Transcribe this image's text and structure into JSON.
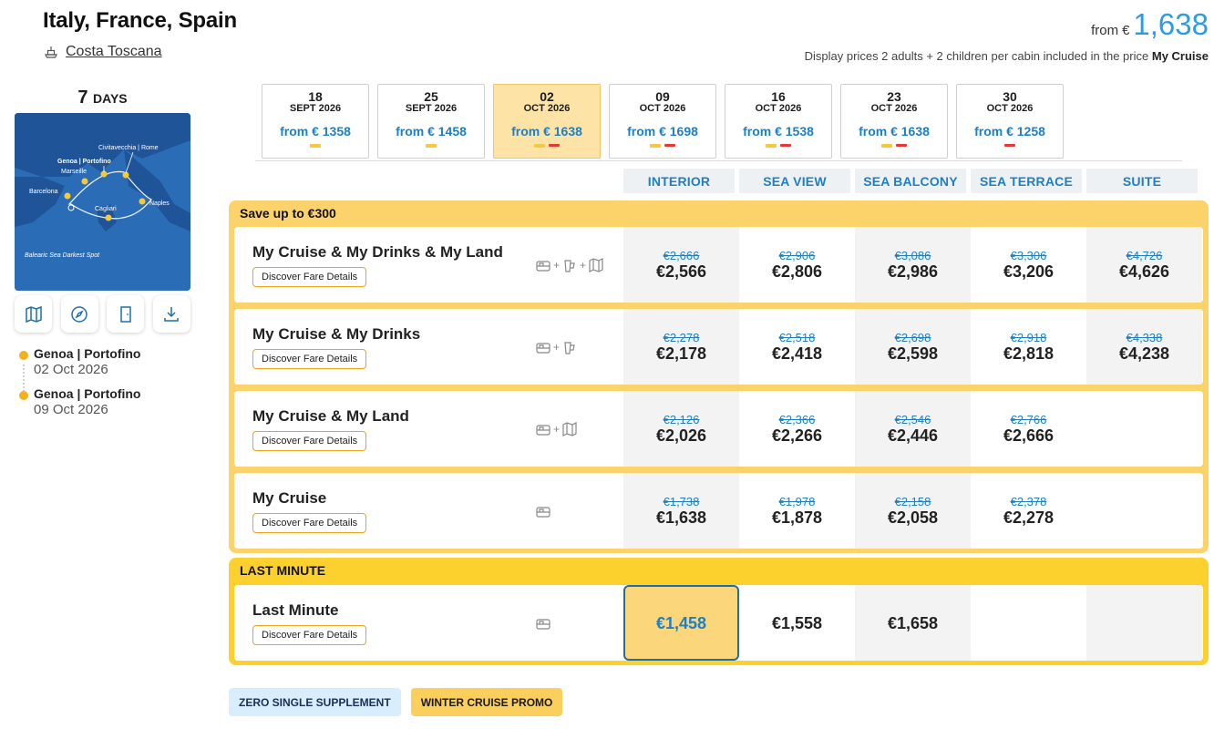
{
  "header": {
    "title": "Italy, France, Spain",
    "ship": "Costa Toscana",
    "from_label": "from",
    "currency": "€",
    "from_amount": "1,638",
    "display_note_prefix": "Display prices 2 adults + 2 children per cabin included in the price",
    "display_note_bold": "My Cruise"
  },
  "sidebar": {
    "days_number": "7",
    "days_unit": "DAYS",
    "map_labels": {
      "civitavecchia": "Civitavecchia | Rome",
      "genoa": "Genoa | Portofino",
      "marseille": "Marseille",
      "barcelona": "Barcelona",
      "naples": "Naples",
      "cagliari": "Cagliari",
      "balearic": "Balearic Sea Darkest Spot"
    },
    "tools": [
      "map-icon",
      "compass-icon",
      "door-icon",
      "download-icon"
    ],
    "itinerary": [
      {
        "port": "Genoa | Portofino",
        "date": "02 Oct 2026"
      },
      {
        "port": "Genoa | Portofino",
        "date": "09 Oct 2026"
      }
    ]
  },
  "dates": [
    {
      "day": "18",
      "month": "SEPT 2026",
      "price": "from € 1358",
      "badges": [
        "yellow"
      ]
    },
    {
      "day": "25",
      "month": "SEPT 2026",
      "price": "from € 1458",
      "badges": [
        "yellow"
      ]
    },
    {
      "day": "02",
      "month": "OCT 2026",
      "price": "from € 1638",
      "badges": [
        "yellow",
        "red"
      ],
      "selected": true
    },
    {
      "day": "09",
      "month": "OCT 2026",
      "price": "from € 1698",
      "badges": [
        "yellow",
        "red"
      ]
    },
    {
      "day": "16",
      "month": "OCT 2026",
      "price": "from € 1538",
      "badges": [
        "yellow",
        "red"
      ]
    },
    {
      "day": "23",
      "month": "OCT 2026",
      "price": "from € 1638",
      "badges": [
        "yellow",
        "red"
      ]
    },
    {
      "day": "30",
      "month": "OCT 2026",
      "price": "from € 1258",
      "badges": [
        "red"
      ]
    }
  ],
  "cabins": [
    "INTERIOR",
    "SEA VIEW",
    "SEA BALCONY",
    "SEA TERRACE",
    "SUITE"
  ],
  "groups": {
    "save": {
      "title": "Save up to €300",
      "rows": [
        {
          "name": "My Cruise & My Drinks & My Land",
          "button": "Discover Fare Details",
          "icons": "cruise+drinks+land",
          "prices": [
            {
              "old": "€2,666",
              "new": "€2,566"
            },
            {
              "old": "€2,906",
              "new": "€2,806"
            },
            {
              "old": "€3,086",
              "new": "€2,986"
            },
            {
              "old": "€3,306",
              "new": "€3,206"
            },
            {
              "old": "€4,726",
              "new": "€4,626"
            }
          ]
        },
        {
          "name": "My Cruise & My Drinks",
          "button": "Discover Fare Details",
          "icons": "cruise+drinks",
          "prices": [
            {
              "old": "€2,278",
              "new": "€2,178"
            },
            {
              "old": "€2,518",
              "new": "€2,418"
            },
            {
              "old": "€2,698",
              "new": "€2,598"
            },
            {
              "old": "€2,918",
              "new": "€2,818"
            },
            {
              "old": "€4,338",
              "new": "€4,238"
            }
          ]
        },
        {
          "name": "My Cruise & My Land",
          "button": "Discover Fare Details",
          "icons": "cruise+land",
          "prices": [
            {
              "old": "€2,126",
              "new": "€2,026"
            },
            {
              "old": "€2,366",
              "new": "€2,266"
            },
            {
              "old": "€2,546",
              "new": "€2,446"
            },
            {
              "old": "€2,766",
              "new": "€2,666"
            },
            {
              "old": "",
              "new": ""
            }
          ]
        },
        {
          "name": "My Cruise",
          "button": "Discover Fare Details",
          "icons": "cruise",
          "prices": [
            {
              "old": "€1,738",
              "new": "€1,638"
            },
            {
              "old": "€1,978",
              "new": "€1,878"
            },
            {
              "old": "€2,158",
              "new": "€2,058"
            },
            {
              "old": "€2,378",
              "new": "€2,278"
            },
            {
              "old": "",
              "new": ""
            }
          ]
        }
      ]
    },
    "last_minute": {
      "title": "LAST MINUTE",
      "rows": [
        {
          "name": "Last Minute",
          "button": "Discover Fare Details",
          "icons": "cruise",
          "prices": [
            {
              "old": "",
              "new": "€1,458"
            },
            {
              "old": "",
              "new": "€1,558"
            },
            {
              "old": "",
              "new": "€1,658"
            },
            {
              "old": "",
              "new": ""
            },
            {
              "old": "",
              "new": ""
            }
          ]
        }
      ]
    }
  },
  "promos": [
    "ZERO SINGLE SUPPLEMENT",
    "WINTER CRUISE PROMO"
  ],
  "colors": {
    "accent_blue": "#2b9de3",
    "yellow_group": "#fcd26a",
    "last_minute": "#fdd12d",
    "selected_date": "#fde4a6"
  }
}
